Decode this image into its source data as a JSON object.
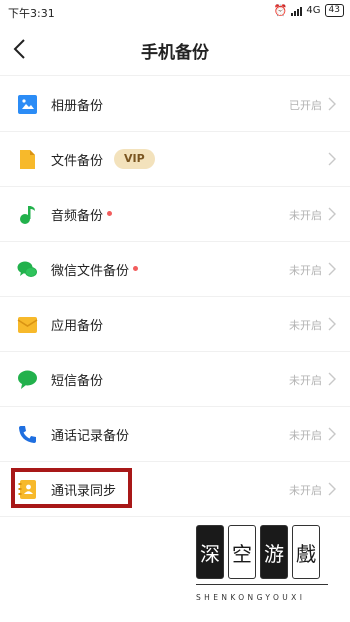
{
  "status_bar": {
    "time": "下午3:31",
    "network": "4G",
    "battery": "43"
  },
  "header": {
    "title": "手机备份"
  },
  "rows": [
    {
      "label": "相册备份",
      "status": "已开启",
      "icon": "album-icon",
      "color": "#2b8cf6"
    },
    {
      "label": "文件备份",
      "badge": "VIP",
      "status": "",
      "icon": "file-icon",
      "color": "#f7b92b"
    },
    {
      "label": "音频备份",
      "status": "未开启",
      "icon": "music-icon",
      "color": "#22b14c",
      "dot": true
    },
    {
      "label": "微信文件备份",
      "status": "未开启",
      "icon": "wechat-icon",
      "color": "#22b14c",
      "dot": true
    },
    {
      "label": "应用备份",
      "status": "未开启",
      "icon": "app-box-icon",
      "color": "#f7b92b"
    },
    {
      "label": "短信备份",
      "status": "未开启",
      "icon": "sms-icon",
      "color": "#22b14c"
    },
    {
      "label": "通话记录备份",
      "status": "未开启",
      "icon": "phone-icon",
      "color": "#1f6fe0"
    },
    {
      "label": "通讯录同步",
      "status": "未开启",
      "icon": "contacts-icon",
      "color": "#f7b92b"
    }
  ],
  "watermark": {
    "chars": [
      "深",
      "空",
      "游",
      "戲"
    ],
    "subtitle": "SHENKONGYOUXI"
  }
}
